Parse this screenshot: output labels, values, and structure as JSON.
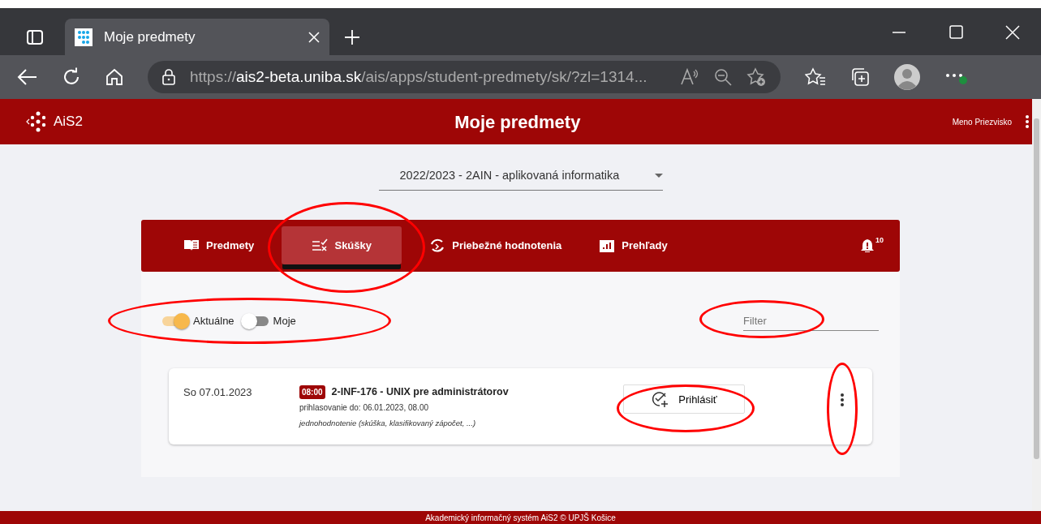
{
  "browser": {
    "tab_title": "Moje predmety",
    "url_scheme": "https://",
    "url_host": "ais2-beta.uniba.sk",
    "url_path": "/ais/apps/student-predmety/sk/?zl=1314..."
  },
  "app": {
    "logo": "AiS2",
    "title": "Moje predmety",
    "user": "Meno Priezvisko"
  },
  "study_select": {
    "value": "2022/2023 - 2AIN - aplikovaná informatika"
  },
  "tabs": [
    {
      "label": "Predmety",
      "selected": false,
      "circled": false
    },
    {
      "label": "Skúšky",
      "selected": true,
      "circled": true
    },
    {
      "label": "Priebežné hodnotenia",
      "selected": false,
      "circled": false
    },
    {
      "label": "Prehľady",
      "selected": false,
      "circled": false
    }
  ],
  "notifications": {
    "count": "10"
  },
  "toggles": {
    "circled": true,
    "items": [
      {
        "label": "Aktuálne",
        "on": true
      },
      {
        "label": "Moje",
        "on": false
      }
    ]
  },
  "filter": {
    "placeholder": "Filter",
    "circled": true
  },
  "exams": [
    {
      "date": "So 07.01.2023",
      "time": "08:00",
      "title": "2-INF-176 - UNIX pre administrátorov",
      "registration": "prihlasovanie do: 06.01.2023, 08.00",
      "type": "jednohodnotenie (skúška, klasifikovaný zápočet, ...)",
      "action": "Prihlásiť",
      "action_circled": true,
      "menu_circled": true
    }
  ],
  "footer": "Akademický informačný systém AiS2 © UPJŠ Košice"
}
